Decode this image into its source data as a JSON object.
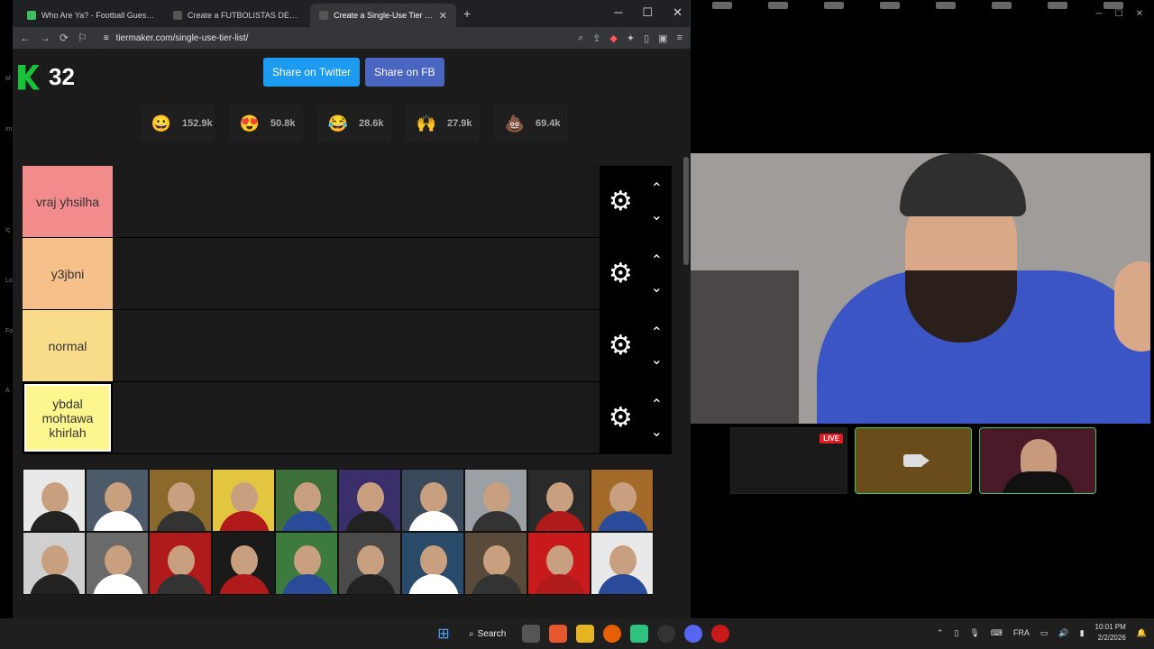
{
  "browser": {
    "tabs": [
      {
        "title": "Who Are Ya? - Football Guesser",
        "active": false
      },
      {
        "title": "Create a FUTBOLISTAS DEL SIGLO Tier",
        "active": false
      },
      {
        "title": "Create a Single-Use Tier List (Pr",
        "active": true
      }
    ],
    "new_tab": "+",
    "win_min": "─",
    "win_max": "☐",
    "win_close": "✕",
    "url": "tiermaker.com/single-use-tier-list/",
    "back": "←",
    "forward": "→",
    "reload": "⟳"
  },
  "page": {
    "logo_number": "32",
    "share_twitter": "Share on Twitter",
    "share_fb": "Share on FB",
    "reactions": [
      {
        "emoji": "😀",
        "count": "152.9k",
        "color": "#f7c948"
      },
      {
        "emoji": "😍",
        "count": "50.8k",
        "color": "#f7c948"
      },
      {
        "emoji": "😂",
        "count": "28.6k",
        "color": "#f7c948"
      },
      {
        "emoji": "🙌",
        "count": "27.9k",
        "color": "#f7c948"
      },
      {
        "emoji": "💩",
        "count": "69.4k",
        "color": "#b06d8b"
      }
    ],
    "tiers": [
      {
        "label": "vraj yhsilha",
        "color": "#f28b8b"
      },
      {
        "label": "y3jbni",
        "color": "#f6c08a"
      },
      {
        "label": "normal",
        "color": "#f8dc8a"
      },
      {
        "label": "ybdal mohtawa khirlah",
        "color": "#fdf58d"
      }
    ],
    "gear_icon": "⚙",
    "arrow_up": "⌃",
    "arrow_down": "⌄"
  },
  "pool_colors": [
    "#e9e9e9",
    "#4d5a6a",
    "#8a6a2a",
    "#e2c640",
    "#3c6f3a",
    "#3a2f6a",
    "#3a4a5c",
    "#9aa0a4",
    "#2a2a2a",
    "#a46a2a",
    "#cfcfcf",
    "#6a6a6a",
    "#b01a1a",
    "#1a1a1a",
    "#3d7a3d",
    "#4a4a4a",
    "#2a4a6a",
    "#5a4a3a",
    "#c81a1a",
    "#e9e9e9"
  ],
  "webcam": {
    "live_badge": "LIVE"
  },
  "taskbar": {
    "search_label": "Search",
    "lang": "FRA",
    "time": "10:01 PM",
    "date": "2/2/2026"
  }
}
